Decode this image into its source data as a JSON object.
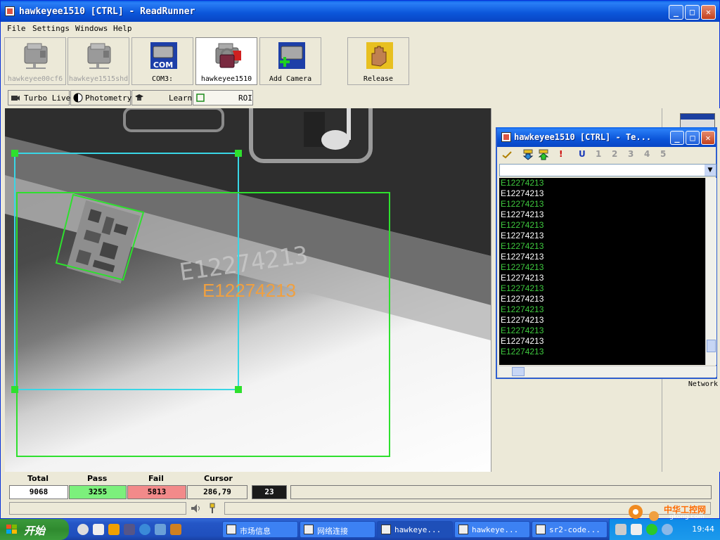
{
  "window": {
    "title": "hawkeyee1510 [CTRL] - ReadRunner"
  },
  "menu": [
    "File",
    "Settings",
    "Windows",
    "Help"
  ],
  "cameras": [
    {
      "label": "hawkeyee00cf6",
      "dim": true
    },
    {
      "label": "hawkeye1515shd",
      "dim": true
    },
    {
      "label": "COM3:",
      "dim": false
    },
    {
      "label": "hawkeyee1510",
      "dim": false
    },
    {
      "label": "Add Camera",
      "dim": false
    },
    {
      "label": "Release",
      "dim": false
    }
  ],
  "modes": [
    "Turbo Live",
    "Photometry",
    "Learn",
    "ROI"
  ],
  "image": {
    "decoded_text": "E12274213"
  },
  "stats": {
    "headers": [
      "Total",
      "Pass",
      "Fail",
      "Cursor"
    ],
    "total": "9068",
    "pass": "3255",
    "fail": "5813",
    "cursor": "286,79",
    "extra": "23"
  },
  "right_panel": {
    "network_label": "Network"
  },
  "terminal": {
    "title": "hawkeyee1510 [CTRL] - Te...",
    "channels": [
      "1",
      "2",
      "3",
      "4",
      "5"
    ],
    "lines": [
      {
        "text": "E12274213",
        "color": "#3ec93e"
      },
      {
        "text": "E12274213",
        "color": "#ffffff"
      },
      {
        "text": "E12274213",
        "color": "#3ec93e"
      },
      {
        "text": "E12274213",
        "color": "#ffffff"
      },
      {
        "text": "E12274213",
        "color": "#3ec93e"
      },
      {
        "text": "E12274213",
        "color": "#ffffff"
      },
      {
        "text": "E12274213",
        "color": "#3ec93e"
      },
      {
        "text": "E12274213",
        "color": "#ffffff"
      },
      {
        "text": "E12274213",
        "color": "#3ec93e"
      },
      {
        "text": "E12274213",
        "color": "#ffffff"
      },
      {
        "text": "E12274213",
        "color": "#3ec93e"
      },
      {
        "text": "E12274213",
        "color": "#ffffff"
      },
      {
        "text": "E12274213",
        "color": "#3ec93e"
      },
      {
        "text": "E12274213",
        "color": "#ffffff"
      },
      {
        "text": "E12274213",
        "color": "#3ec93e"
      },
      {
        "text": "E12274213",
        "color": "#ffffff"
      },
      {
        "text": "E12274213",
        "color": "#3ec93e"
      }
    ]
  },
  "taskbar": {
    "start": "开始",
    "tasks": [
      "市场信息",
      "网络连接",
      "hawkeye...",
      "hawkeye...",
      "sr2-code..."
    ],
    "clock": "19:44",
    "watermark": "中华工控网",
    "watermark_url": "gkong.com"
  },
  "colors": {
    "pass": "#7cf07c",
    "fail": "#f28a8a",
    "roi": "#2ee02e",
    "cyan": "#39d6e6",
    "decoded": "#f0a040"
  }
}
